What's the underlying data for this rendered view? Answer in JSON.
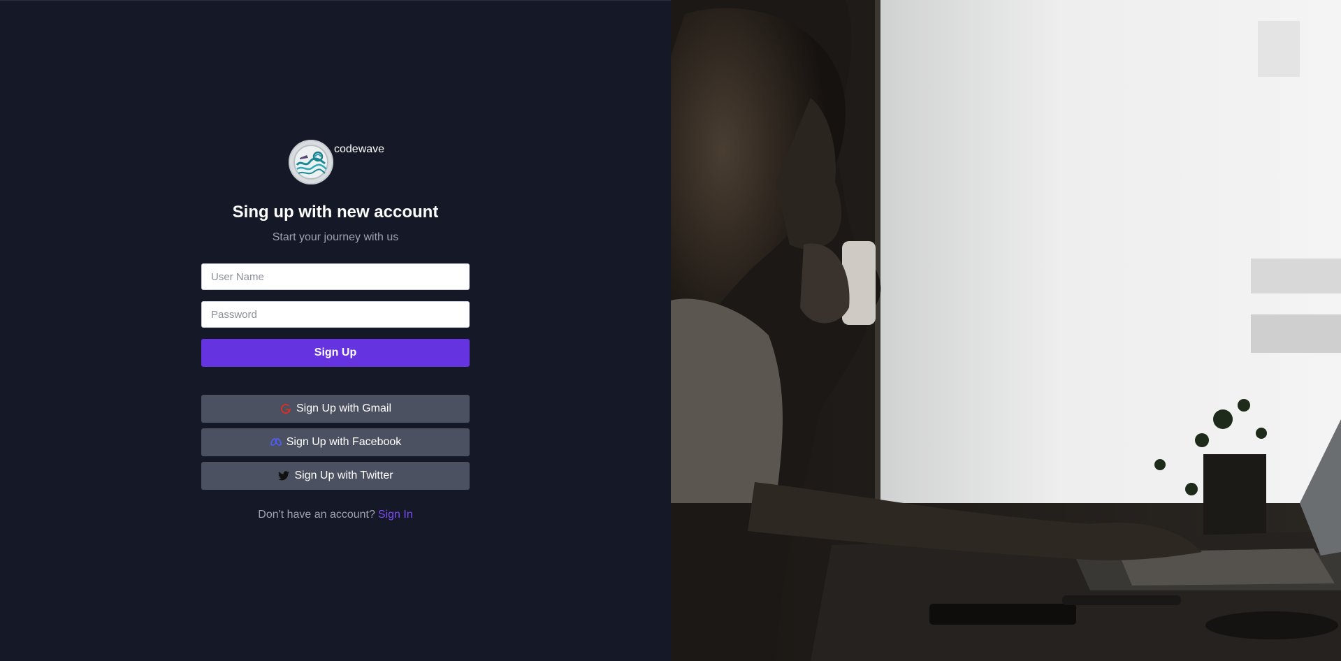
{
  "brand": {
    "name": "codewave",
    "logo_icon": "codewave-wave-logo"
  },
  "form": {
    "title": "Sing up with new account",
    "subtitle": "Start your journey with us",
    "username_placeholder": "User Name",
    "password_placeholder": "Password",
    "submit_label": "Sign Up"
  },
  "social": [
    {
      "label": "Sign Up with Gmail",
      "icon": "google-icon",
      "icon_color": "#d93025"
    },
    {
      "label": "Sign Up with Facebook",
      "icon": "facebook-icon",
      "icon_color": "#4e5df5"
    },
    {
      "label": "Sign Up with Twitter",
      "icon": "twitter-icon",
      "icon_color": "#111111"
    }
  ],
  "footer": {
    "prompt": "Don't have an account?",
    "link_label": "Sign In"
  },
  "colors": {
    "background": "#141827",
    "primary": "#6633e0",
    "social_button": "#4b5160",
    "link": "#7c4df5"
  }
}
